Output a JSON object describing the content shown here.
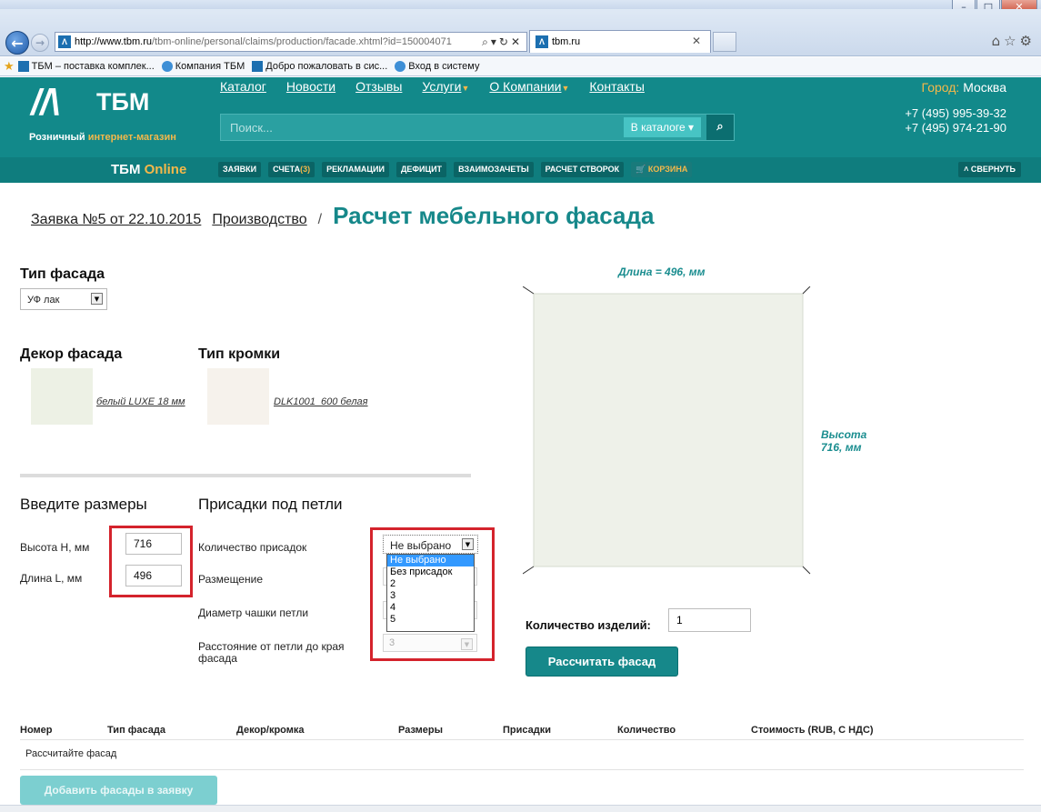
{
  "browser": {
    "url_host": "http://www.tbm.ru",
    "url_path": "/tbm-online/personal/claims/production/facade.xhtml?id=150004071",
    "tab_title": "tbm.ru",
    "favorites": [
      {
        "label": "ТБМ – поставка комплек...",
        "icon": "tbm"
      },
      {
        "label": "Компания ТБМ",
        "icon": "ie"
      },
      {
        "label": "Добро пожаловать в сис...",
        "icon": "tbm"
      },
      {
        "label": "Вход в систему",
        "icon": "ie"
      }
    ]
  },
  "site": {
    "logo": "ТБМ",
    "tagline_1": "Розничный",
    "tagline_2": "интернет-магазин",
    "nav": [
      "Каталог",
      "Новости",
      "Отзывы",
      "Услуги",
      "О Компании",
      "Контакты"
    ],
    "search_placeholder": "Поиск...",
    "search_scope": "В каталоге",
    "city_label": "Город:",
    "city": "Москва",
    "phones": [
      "+7 (495) 995-39-32",
      "+7 (495) 974-21-90"
    ],
    "online_brand": "ТБМ",
    "online_word": "Online",
    "subnav": [
      "ЗАЯВКИ",
      "СЧЕТА",
      "РЕКЛАМАЦИИ",
      "ДЕФИЦИТ",
      "ВЗАИМОЗАЧЕТЫ",
      "РАСЧЕТ СТВОРОК"
    ],
    "invoices_count": "(3)",
    "cart": "КОРЗИНА",
    "collapse": "СВЕРНУТЬ"
  },
  "page": {
    "crumb_claim": "Заявка №5 от 22.10.2015",
    "crumb_production": "Производство",
    "separator": "/",
    "title": "Расчет мебельного фасада",
    "facade_type_label": "Тип фасада",
    "facade_type_value": "УФ лак",
    "decor_label": "Декор фасада",
    "decor_value": "белый LUXE 18 мм",
    "edge_label": "Тип кромки",
    "edge_value": "DLK1001_600 белая",
    "sizes_title": "Введите размеры",
    "height_label": "Высота H, мм",
    "height_value": "716",
    "length_label": "Длина L, мм",
    "length_value": "496",
    "hinges_title": "Присадки под петли",
    "hinge_count_label": "Количество присадок",
    "hinge_count_value": "Не выбрано",
    "hinge_options": [
      "Не выбрано",
      "Без присадок",
      "2",
      "3",
      "4",
      "5"
    ],
    "placement_label": "Размещение",
    "cup_diameter_label": "Диаметр чашки петли",
    "edge_distance_label": "Расстояние от петли до края фасада",
    "edge_distance_value": "3",
    "preview_length": "Длина = 496, мм",
    "preview_height_1": "Высота",
    "preview_height_2": "716, мм",
    "qty_label": "Количество изделий:",
    "qty_value": "1",
    "calc_button": "Рассчитать фасад",
    "table_headers": [
      "Номер",
      "Тип фасада",
      "Декор/кромка",
      "Размеры",
      "Присадки",
      "Количество",
      "Стоимость (RUB, С НДС)"
    ],
    "table_empty": "Рассчитайте фасад",
    "add_button": "Добавить фасады в заявку"
  },
  "colors": {
    "brand_teal": "#12898a",
    "accent_orange": "#f4b84a",
    "highlight_red": "#d4232c",
    "facade_fill": "#eef1e9"
  }
}
